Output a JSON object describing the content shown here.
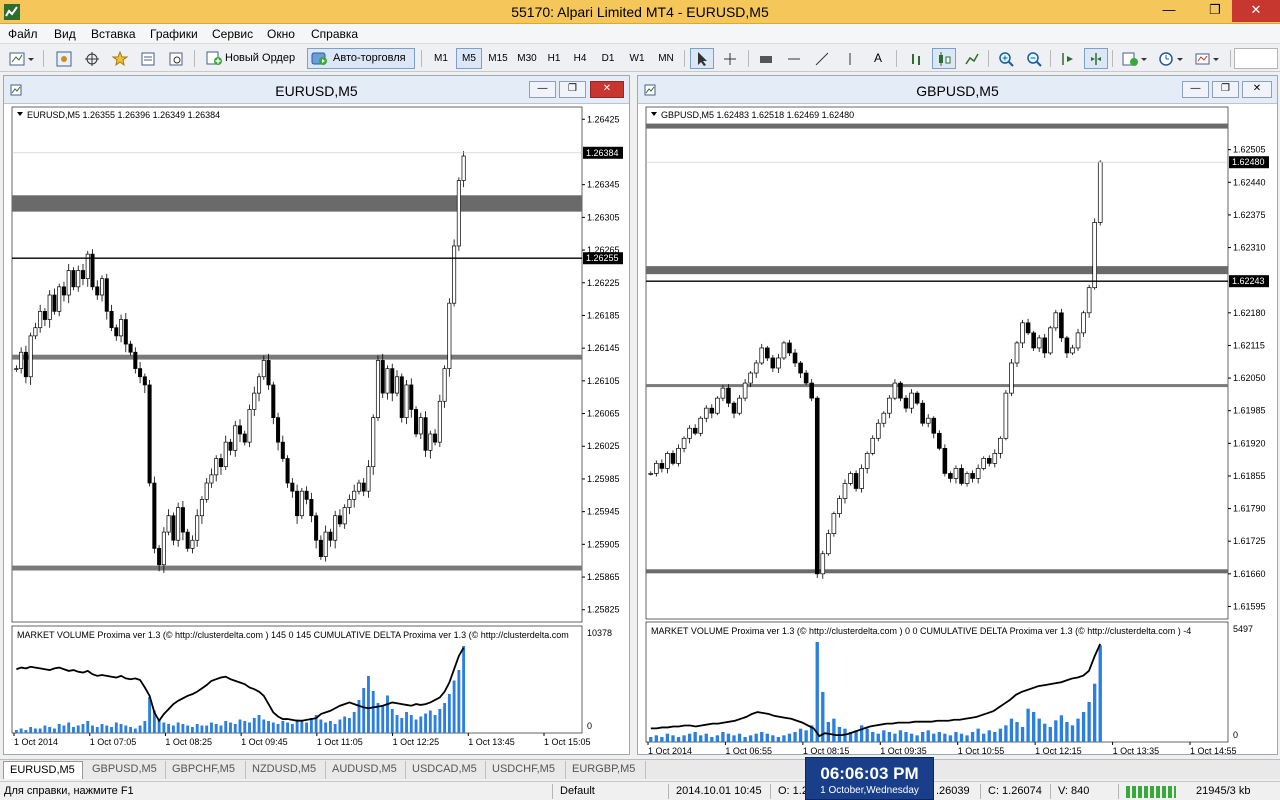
{
  "window": {
    "title": "55170: Alpari Limited MT4 - EURUSD,M5"
  },
  "menu": [
    "Файл",
    "Вид",
    "Вставка",
    "Графики",
    "Сервис",
    "Окно",
    "Справка"
  ],
  "toolbar": {
    "new_order": "Новый Ордер",
    "auto_trading": "Авто-торговля",
    "timeframes": [
      "M1",
      "M5",
      "M15",
      "M30",
      "H1",
      "H4",
      "D1",
      "W1",
      "MN"
    ],
    "active_timeframe": "M5",
    "text_tool": "A"
  },
  "charts": [
    {
      "window_title": "EURUSD,M5",
      "info": "EURUSD,M5  1.26355 1.26396 1.26349 1.26384",
      "price_axis": [
        "1.26425",
        "1.26345",
        "1.26305",
        "1.26265",
        "1.26225",
        "1.26185",
        "1.26145",
        "1.26105",
        "1.26065",
        "1.26025",
        "1.25985",
        "1.25945",
        "1.25905",
        "1.25865",
        "1.25825"
      ],
      "price_min": 1.2581,
      "price_max": 1.2644,
      "current_price_label": "1.26384",
      "line_price_label": "1.26255",
      "time_axis": [
        "1 Oct 2014",
        "1 Oct 07:05",
        "1 Oct 08:25",
        "1 Oct 09:45",
        "1 Oct 11:05",
        "1 Oct 12:25",
        "1 Oct 13:45",
        "1 Oct 15:05"
      ],
      "indicator_text": "MARKET VOLUME Proxima ver 1.3 (© http://clusterdelta.com ) 145 0 145  CUMULATIVE DELTA Proxima ver 1.3 (© http://clusterdelta.com",
      "indicator_max": "10378",
      "indicator_zero": "0",
      "closes": [
        1.2612,
        1.2614,
        1.2611,
        1.2616,
        1.2617,
        1.2619,
        1.2618,
        1.2621,
        1.2619,
        1.2622,
        1.2621,
        1.2624,
        1.2622,
        1.2624,
        1.2623,
        1.2626,
        1.2622,
        1.2621,
        1.2623,
        1.2619,
        1.2617,
        1.2616,
        1.2618,
        1.2615,
        1.2614,
        1.2612,
        1.2611,
        1.261,
        1.2598,
        1.259,
        1.2588,
        1.2592,
        1.2594,
        1.2591,
        1.2595,
        1.2592,
        1.259,
        1.2591,
        1.2594,
        1.2596,
        1.2598,
        1.2599,
        1.2601,
        1.26,
        1.2603,
        1.2602,
        1.2605,
        1.2604,
        1.2603,
        1.2607,
        1.2609,
        1.2611,
        1.2613,
        1.261,
        1.2606,
        1.2603,
        1.2601,
        1.2598,
        1.2597,
        1.2594,
        1.2597,
        1.2596,
        1.2594,
        1.2591,
        1.2589,
        1.2592,
        1.2591,
        1.2594,
        1.2593,
        1.2595,
        1.2596,
        1.2597,
        1.2598,
        1.2597,
        1.26,
        1.2606,
        1.2613,
        1.2609,
        1.2612,
        1.2609,
        1.2611,
        1.2606,
        1.261,
        1.2607,
        1.2604,
        1.2606,
        1.2602,
        1.2604,
        1.2603,
        1.2608,
        1.2612,
        1.262,
        1.2627,
        1.2635,
        1.2638
      ],
      "volumes": [
        2,
        3,
        2,
        4,
        3,
        3,
        5,
        4,
        3,
        6,
        5,
        7,
        4,
        5,
        6,
        8,
        5,
        4,
        6,
        5,
        4,
        7,
        6,
        5,
        4,
        3,
        5,
        8,
        24,
        15,
        9,
        7,
        6,
        5,
        7,
        6,
        5,
        4,
        6,
        5,
        5,
        7,
        6,
        5,
        8,
        7,
        6,
        9,
        8,
        7,
        10,
        12,
        9,
        8,
        7,
        6,
        8,
        7,
        6,
        9,
        8,
        7,
        10,
        12,
        9,
        7,
        8,
        6,
        9,
        11,
        10,
        14,
        22,
        30,
        38,
        28,
        20,
        18,
        25,
        16,
        12,
        10,
        14,
        12,
        9,
        11,
        13,
        15,
        12,
        16,
        20,
        26,
        35,
        42,
        58
      ],
      "delta": [
        0.72,
        0.74,
        0.73,
        0.75,
        0.74,
        0.73,
        0.72,
        0.71,
        0.73,
        0.74,
        0.72,
        0.7,
        0.71,
        0.69,
        0.68,
        0.7,
        0.66,
        0.64,
        0.65,
        0.64,
        0.63,
        0.62,
        0.64,
        0.61,
        0.6,
        0.61,
        0.59,
        0.5,
        0.4,
        0.2,
        0.1,
        0.18,
        0.24,
        0.3,
        0.34,
        0.37,
        0.4,
        0.42,
        0.45,
        0.49,
        0.53,
        0.58,
        0.6,
        0.62,
        0.63,
        0.6,
        0.58,
        0.56,
        0.54,
        0.5,
        0.48,
        0.45,
        0.4,
        0.3,
        0.2,
        0.15,
        0.12,
        0.12,
        0.11,
        0.1,
        0.1,
        0.11,
        0.12,
        0.13,
        0.18,
        0.2,
        0.22,
        0.25,
        0.28,
        0.3,
        0.32,
        0.3,
        0.28,
        0.26,
        0.25,
        0.26,
        0.27,
        0.28,
        0.3,
        0.32,
        0.31,
        0.3,
        0.29,
        0.28,
        0.3,
        0.29,
        0.3,
        0.32,
        0.35,
        0.38,
        0.45,
        0.56,
        0.72,
        0.88,
        0.98
      ],
      "zones": [
        {
          "price": 1.26322,
          "thickness": 0.0002,
          "color": "#6a6a6a"
        },
        {
          "price": 1.26134,
          "thickness": 6e-05,
          "color": "#7a7a7a"
        },
        {
          "price": 1.25876,
          "thickness": 6e-05,
          "color": "#7a7a7a"
        }
      ]
    },
    {
      "window_title": "GBPUSD,M5",
      "info": "GBPUSD,M5  1.62483 1.62518 1.62469 1.62480",
      "price_axis": [
        "1.62505",
        "1.62440",
        "1.62375",
        "1.62310",
        "1.62180",
        "1.62115",
        "1.62050",
        "1.61985",
        "1.61920",
        "1.61855",
        "1.61790",
        "1.61725",
        "1.61660",
        "1.61595"
      ],
      "price_min": 1.6157,
      "price_max": 1.6259,
      "current_price_label": "1.62480",
      "line_price_label": "1.62243",
      "time_axis": [
        "1 Oct 2014",
        "1 Oct 06:55",
        "1 Oct 08:15",
        "1 Oct 09:35",
        "1 Oct 10:55",
        "1 Oct 12:15",
        "1 Oct 13:35",
        "1 Oct 14:55"
      ],
      "indicator_text": "MARKET VOLUME Proxima ver 1.3 (© http://clusterdelta.com ) 0 0  CUMULATIVE DELTA Proxima ver 1.3 (© http://clusterdelta.com ) -4",
      "indicator_max": "5497",
      "indicator_zero": "0",
      "closes": [
        1.6186,
        1.6188,
        1.6187,
        1.619,
        1.6188,
        1.6191,
        1.6193,
        1.6195,
        1.6194,
        1.6197,
        1.6199,
        1.6198,
        1.6201,
        1.6203,
        1.62,
        1.6198,
        1.6201,
        1.6204,
        1.6206,
        1.6208,
        1.6211,
        1.6209,
        1.6207,
        1.6209,
        1.6212,
        1.621,
        1.6208,
        1.6206,
        1.6204,
        1.6201,
        1.6166,
        1.617,
        1.6174,
        1.6178,
        1.6181,
        1.6184,
        1.6186,
        1.6183,
        1.6187,
        1.619,
        1.6193,
        1.6196,
        1.6198,
        1.6201,
        1.6204,
        1.6201,
        1.6199,
        1.6202,
        1.62,
        1.6196,
        1.6197,
        1.6194,
        1.6191,
        1.6186,
        1.6185,
        1.6187,
        1.6184,
        1.6186,
        1.6185,
        1.6187,
        1.6189,
        1.6188,
        1.619,
        1.6193,
        1.6202,
        1.6208,
        1.6212,
        1.6216,
        1.6214,
        1.6211,
        1.6213,
        1.621,
        1.6215,
        1.6218,
        1.6213,
        1.621,
        1.6211,
        1.6214,
        1.6218,
        1.6223,
        1.6236,
        1.6248
      ],
      "volumes": [
        3,
        4,
        3,
        5,
        4,
        3,
        4,
        5,
        6,
        4,
        5,
        3,
        4,
        6,
        5,
        4,
        5,
        3,
        4,
        5,
        6,
        5,
        4,
        3,
        4,
        5,
        6,
        8,
        7,
        10,
        60,
        30,
        12,
        14,
        9,
        8,
        6,
        7,
        10,
        8,
        6,
        5,
        7,
        6,
        5,
        7,
        6,
        5,
        4,
        6,
        7,
        5,
        6,
        5,
        4,
        6,
        5,
        4,
        6,
        8,
        5,
        7,
        6,
        8,
        10,
        14,
        12,
        9,
        20,
        18,
        14,
        11,
        9,
        13,
        16,
        12,
        10,
        14,
        18,
        24,
        35,
        58
      ],
      "delta": [
        0.1,
        0.1,
        0.11,
        0.11,
        0.12,
        0.12,
        0.13,
        0.13,
        0.12,
        0.13,
        0.14,
        0.15,
        0.15,
        0.16,
        0.17,
        0.18,
        0.2,
        0.22,
        0.25,
        0.27,
        0.26,
        0.25,
        0.23,
        0.22,
        0.21,
        0.2,
        0.18,
        0.16,
        0.13,
        0.1,
        0.02,
        0.05,
        0.04,
        0.03,
        0.03,
        0.04,
        0.06,
        0.08,
        0.1,
        0.12,
        0.13,
        0.14,
        0.15,
        0.15,
        0.16,
        0.16,
        0.16,
        0.17,
        0.17,
        0.17,
        0.17,
        0.18,
        0.18,
        0.18,
        0.19,
        0.19,
        0.2,
        0.21,
        0.22,
        0.24,
        0.26,
        0.28,
        0.32,
        0.36,
        0.4,
        0.45,
        0.48,
        0.5,
        0.52,
        0.54,
        0.55,
        0.56,
        0.57,
        0.58,
        0.6,
        0.62,
        0.63,
        0.65,
        0.7,
        0.85,
        0.98
      ],
      "zones": [
        {
          "price": 1.62552,
          "thickness": 0.0001,
          "color": "#6a6a6a"
        },
        {
          "price": 1.62265,
          "thickness": 0.00016,
          "color": "#6a6a6a"
        },
        {
          "price": 1.62035,
          "thickness": 6e-05,
          "color": "#7a7a7a"
        },
        {
          "price": 1.61665,
          "thickness": 8e-05,
          "color": "#6a6a6a"
        }
      ]
    }
  ],
  "tabs": [
    "EURUSD,M5",
    "GBPUSD,M5",
    "GBPCHF,M5",
    "NZDUSD,M5",
    "AUDUSD,M5",
    "USDCAD,M5",
    "USDCHF,M5",
    "EURGBP,M5"
  ],
  "active_tab": "EURUSD,M5",
  "status": {
    "help": "Для справки, нажмите F1",
    "profile": "Default",
    "datetime": "2014.10.01 10:45",
    "open": "O: 1.2",
    "high": ".26039",
    "close": "C: 1.26074",
    "volume": "V: 840",
    "traffic": "21945/3 kb"
  },
  "clock": {
    "time": "06:06:03 PM",
    "date": "1 October,Wednesday"
  },
  "colors": {
    "titlebar": "#f5c65a",
    "zone": "#6a6a6a",
    "clock_bg": "#1a3f8a",
    "volume_bar": "#2a7fe0",
    "close": "#c7372f"
  }
}
